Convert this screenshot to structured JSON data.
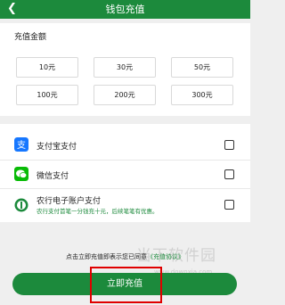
{
  "header": {
    "back_icon": "chevron-left-icon",
    "title": "钱包充值"
  },
  "amount": {
    "label": "充值金额",
    "options": [
      "10元",
      "30元",
      "50元",
      "100元",
      "200元",
      "300元"
    ]
  },
  "payment": {
    "methods": [
      {
        "name": "支付宝支付",
        "icon": "alipay-icon",
        "color": "#1677ff"
      },
      {
        "name": "微信支付",
        "icon": "wechat-pay-icon",
        "color": "#09bb07"
      },
      {
        "name": "农行电子账户支付",
        "icon": "abc-bank-icon",
        "color": "#1c8a3c",
        "note": "农行支付首笔一分钱充十元，后续笔笔有优惠。"
      }
    ]
  },
  "agreement": {
    "text": "点击立即充值即表示您已同意",
    "link": "《充值协议》"
  },
  "submit": {
    "label": "立即充值"
  },
  "watermark": {
    "title": "当下软件园",
    "url": "www.downxia.com"
  },
  "colors": {
    "brand": "#1c8a3c",
    "highlight": "#e00000"
  }
}
